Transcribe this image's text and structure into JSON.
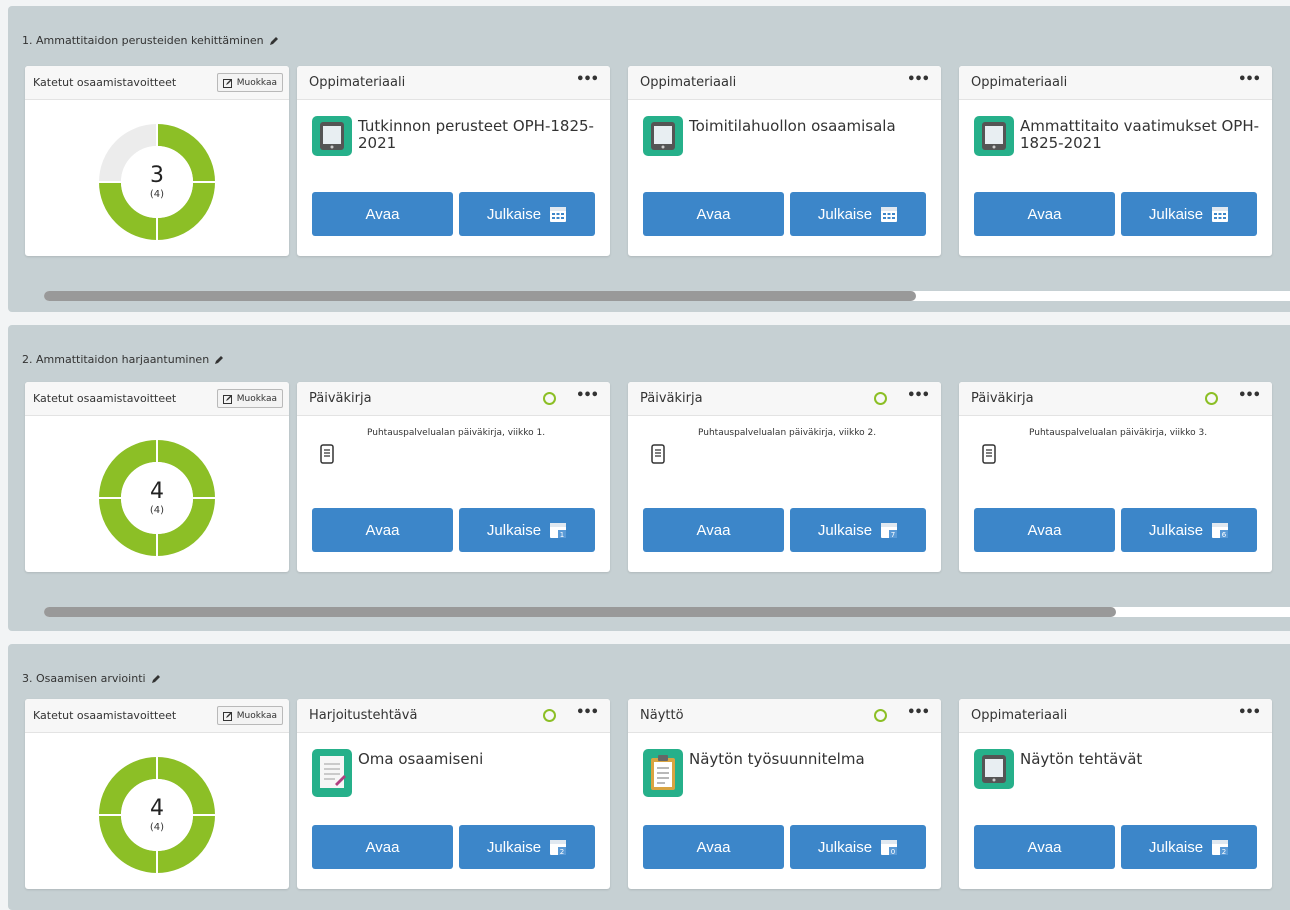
{
  "goal_card": {
    "title": "Katetut osaamistavoitteet",
    "edit_label": "Muokkaa"
  },
  "buttons": {
    "open": "Avaa",
    "publish": "Julkaise"
  },
  "colors": {
    "section_bg": "#c6d0d3",
    "button_blue": "#3c86c9",
    "donut_green": "#8cbf26",
    "donut_empty": "#ececec",
    "resource_teal": "#26b08a"
  },
  "sections": [
    {
      "title": "1. Ammattitaidon perusteiden kehittäminen",
      "goals": {
        "covered": "3",
        "total": "(4)",
        "covered_fraction": 0.75
      },
      "scroll_fraction": 0.7,
      "cards": [
        {
          "type": "Oppimateriaali",
          "title": "Tutkinnon perusteet OPH-1825-2021",
          "icon": "tablet-icon",
          "status": false,
          "calendar_day": ""
        },
        {
          "type": "Oppimateriaali",
          "title": "Toimitilahuollon osaamisala",
          "icon": "tablet-icon",
          "status": false,
          "calendar_day": ""
        },
        {
          "type": "Oppimateriaali",
          "title": "Ammattitaito vaatimukset OPH-1825-2021",
          "icon": "tablet-icon",
          "status": false,
          "calendar_day": ""
        }
      ]
    },
    {
      "title": "2. Ammattitaidon harjaantuminen",
      "goals": {
        "covered": "4",
        "total": "(4)",
        "covered_fraction": 1.0
      },
      "scroll_fraction": 0.86,
      "cards": [
        {
          "type": "Päiväkirja",
          "title": "Puhtauspalvelualan päiväkirja, viikko 1.",
          "icon": "notebook-icon",
          "status": true,
          "calendar_day": "1"
        },
        {
          "type": "Päiväkirja",
          "title": "Puhtauspalvelualan päiväkirja, viikko 2.",
          "icon": "notebook-icon",
          "status": true,
          "calendar_day": "7"
        },
        {
          "type": "Päiväkirja",
          "title": "Puhtauspalvelualan päiväkirja, viikko 3.",
          "icon": "notebook-icon",
          "status": true,
          "calendar_day": "6"
        }
      ]
    },
    {
      "title": "3. Osaamisen arviointi",
      "goals": {
        "covered": "4",
        "total": "(4)",
        "covered_fraction": 1.0
      },
      "scroll_fraction": null,
      "cards": [
        {
          "type": "Harjoitustehtävä",
          "title": "Oma osaamiseni",
          "icon": "document-pen-icon",
          "status": true,
          "calendar_day": "2"
        },
        {
          "type": "Näyttö",
          "title": "Näytön työsuunnitelma",
          "icon": "clipboard-icon",
          "status": true,
          "calendar_day": "0"
        },
        {
          "type": "Oppimateriaali",
          "title": "Näytön tehtävät",
          "icon": "tablet-icon",
          "status": false,
          "calendar_day": "2"
        }
      ]
    }
  ]
}
